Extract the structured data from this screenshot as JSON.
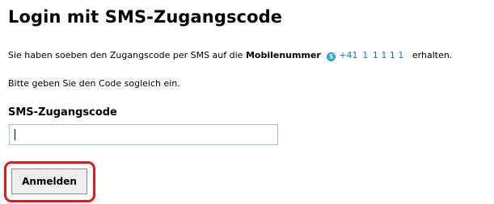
{
  "heading": "Login mit SMS-Zugangscode",
  "info": {
    "text_before": "Sie haben soeben den Zugangscode per SMS auf die",
    "label_bold": "Mobilenummer",
    "phone_icon": "skype-icon",
    "phone_number": "+41  1  1 1 1 1  ",
    "text_after": "erhalten."
  },
  "instruction": "Bitte geben Sie den Code sogleich ein.",
  "field": {
    "label": "SMS-Zugangscode",
    "value": "",
    "placeholder": ""
  },
  "button": {
    "label": "Anmelden"
  },
  "colors": {
    "highlight": "#e0191f",
    "phone_link": "#1a73c8",
    "input_border": "#9fc4e3"
  }
}
